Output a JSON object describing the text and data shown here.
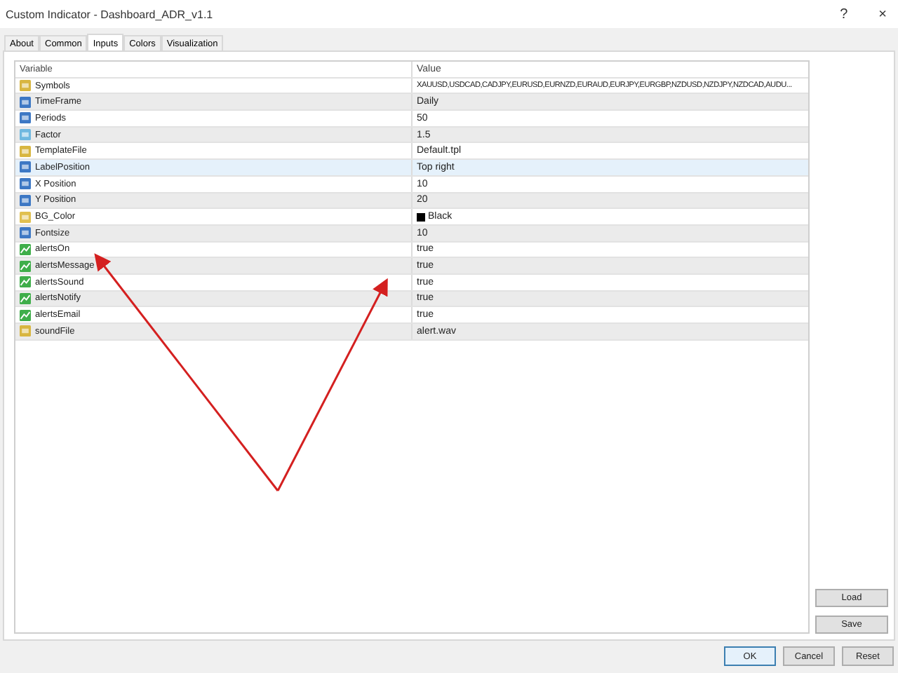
{
  "window": {
    "title": "Custom Indicator - Dashboard_ADR_v1.1",
    "help": "?",
    "close": "×"
  },
  "tabs": [
    {
      "label": "About",
      "selected": false
    },
    {
      "label": "Common",
      "selected": false
    },
    {
      "label": "Inputs",
      "selected": true
    },
    {
      "label": "Colors",
      "selected": false
    },
    {
      "label": "Visualization",
      "selected": false
    }
  ],
  "table": {
    "columns": [
      "Variable",
      "Value"
    ],
    "rows": [
      {
        "kind": "string",
        "variable": "Symbols",
        "value": "XAUUSD,USDCAD,CADJPY,EURUSD,EURNZD,EURAUD,EURJPY,EURGBP,NZDUSD,NZDJPY,NZDCAD,AUDU...",
        "selected": false
      },
      {
        "kind": "int",
        "variable": "TimeFrame",
        "value": "Daily",
        "selected": false
      },
      {
        "kind": "int",
        "variable": "Periods",
        "value": "50",
        "selected": false
      },
      {
        "kind": "double",
        "variable": "Factor",
        "value": "1.5",
        "selected": false
      },
      {
        "kind": "string",
        "variable": "TemplateFile",
        "value": "Default.tpl",
        "selected": false
      },
      {
        "kind": "int",
        "variable": "LabelPosition",
        "value": "Top right",
        "selected": true
      },
      {
        "kind": "int",
        "variable": "X Position",
        "value": "10",
        "selected": false
      },
      {
        "kind": "int",
        "variable": "Y Position",
        "value": "20",
        "selected": false
      },
      {
        "kind": "color",
        "variable": "BG_Color",
        "value": "Black",
        "color": "#000000",
        "selected": false
      },
      {
        "kind": "int",
        "variable": "Fontsize",
        "value": "10",
        "selected": false
      },
      {
        "kind": "bool",
        "variable": "alertsOn",
        "value": "true",
        "selected": false
      },
      {
        "kind": "bool",
        "variable": "alertsMessage",
        "value": "true",
        "selected": false
      },
      {
        "kind": "bool",
        "variable": "alertsSound",
        "value": "true",
        "selected": false
      },
      {
        "kind": "bool",
        "variable": "alertsNotify",
        "value": "true",
        "selected": false
      },
      {
        "kind": "bool",
        "variable": "alertsEmail",
        "value": "true",
        "selected": false
      },
      {
        "kind": "string",
        "variable": "soundFile",
        "value": "alert.wav",
        "selected": false
      }
    ]
  },
  "side_buttons": [
    "Load",
    "Save"
  ],
  "buttons": [
    "OK",
    "Cancel",
    "Reset"
  ]
}
